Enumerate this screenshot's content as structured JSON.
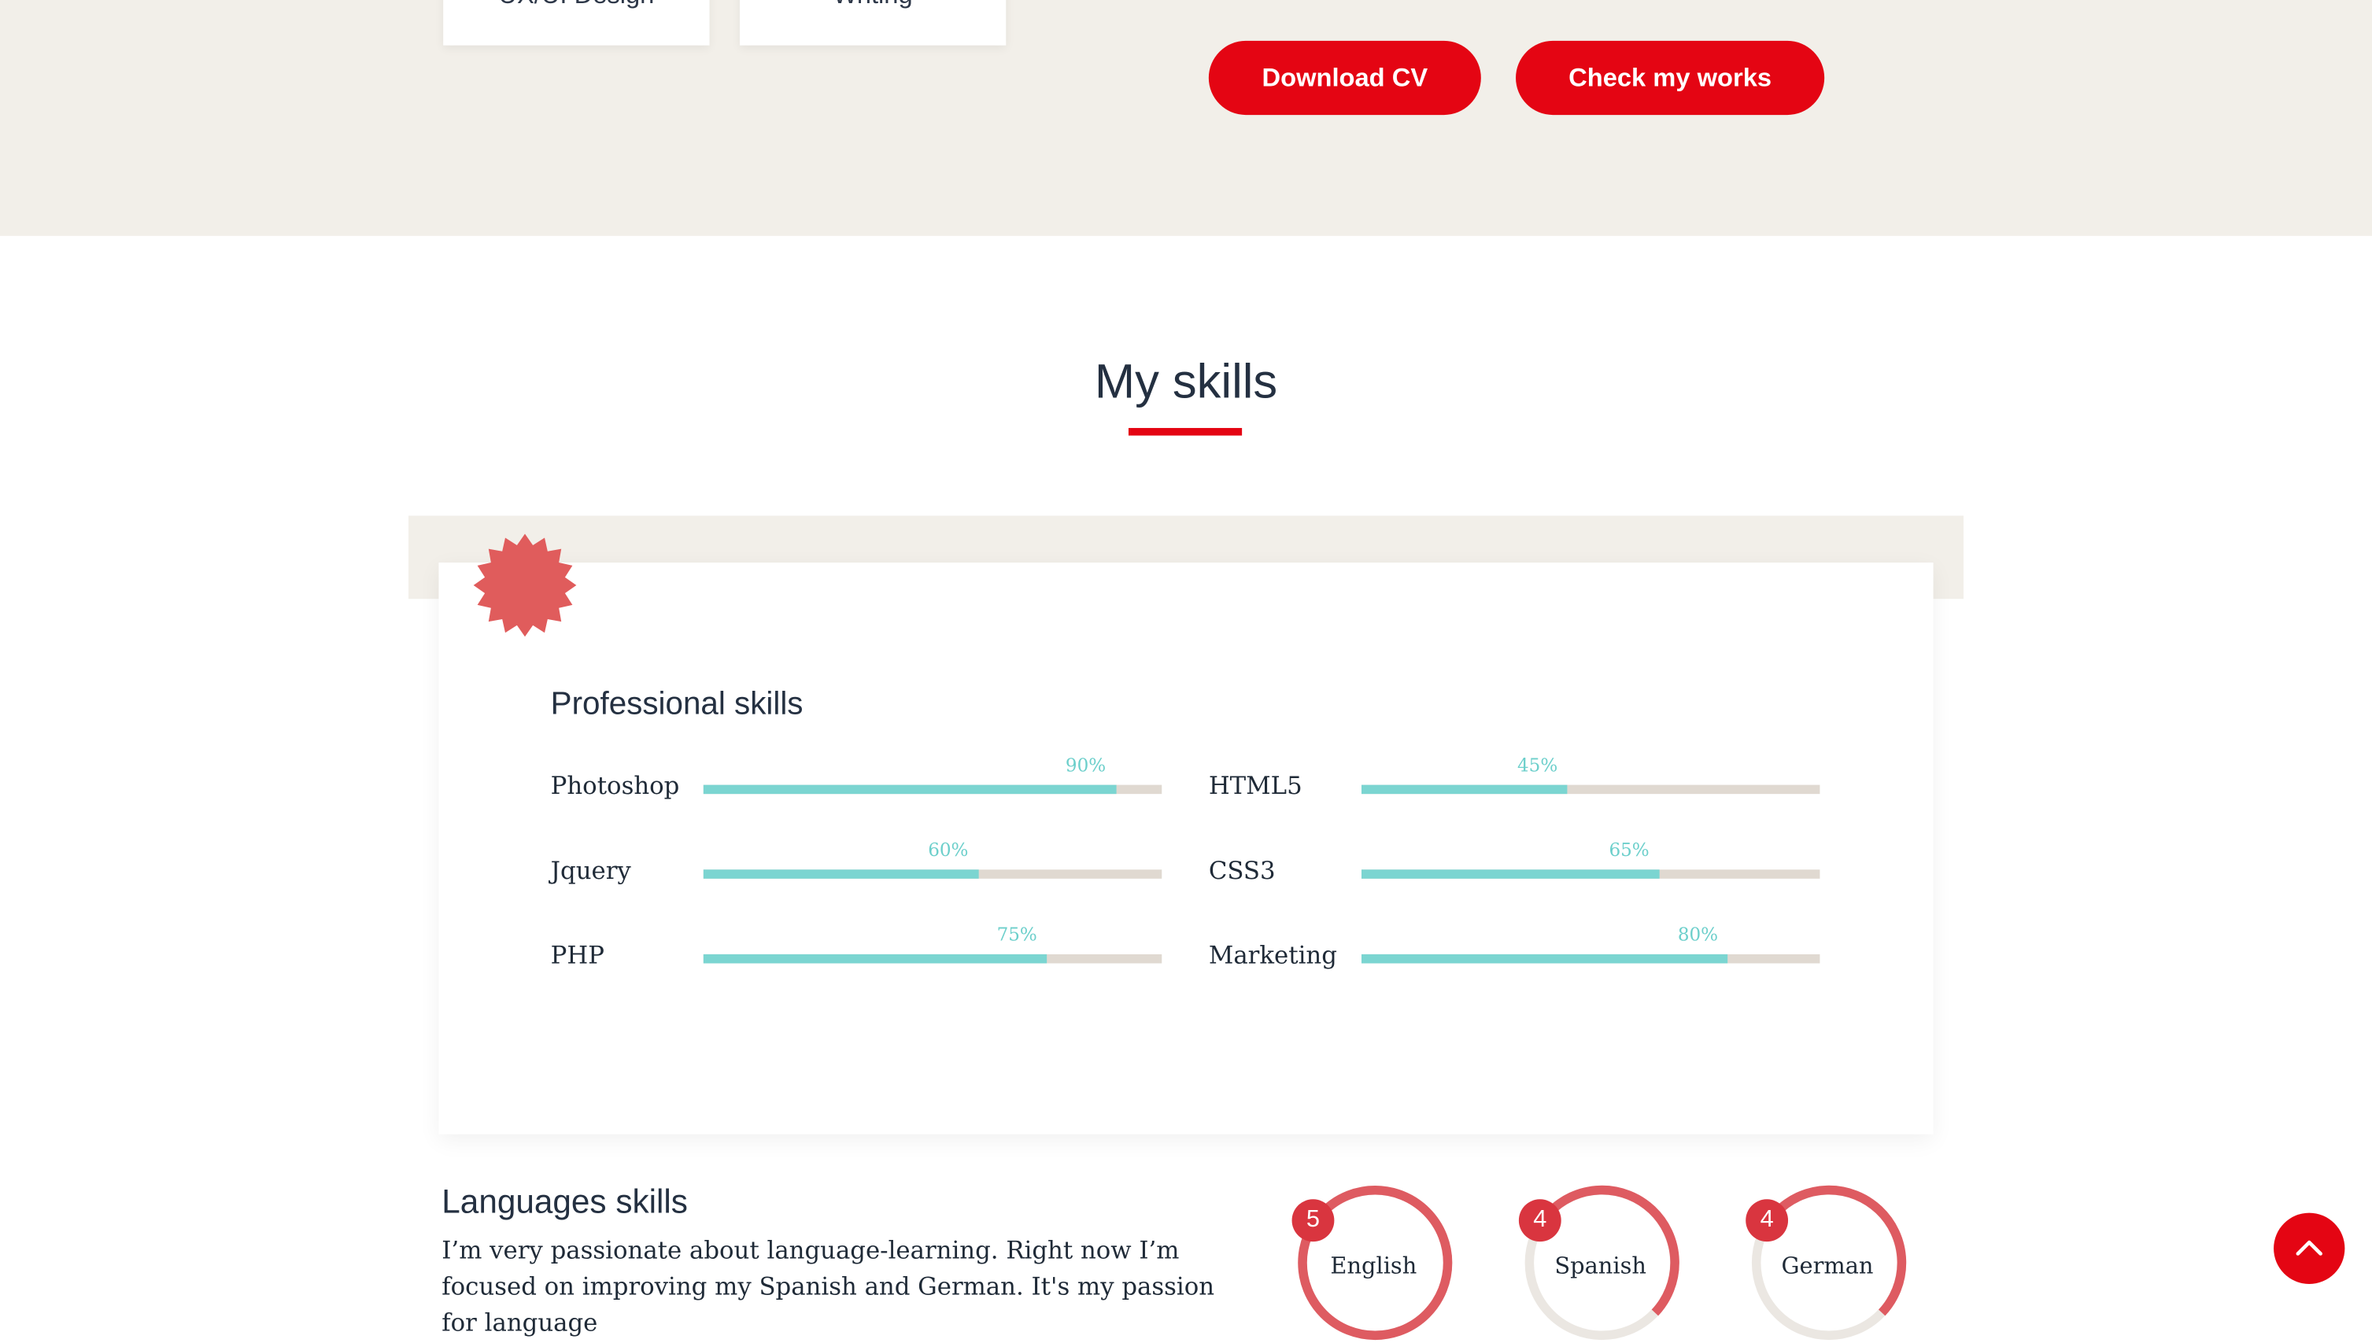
{
  "services": [
    {
      "label": "UX/UI Design"
    },
    {
      "label": "Writing"
    }
  ],
  "actions": {
    "download_cv": "Download CV",
    "check_works": "Check my works"
  },
  "skills_section": {
    "title": "My skills",
    "card_title": "Professional skills",
    "skills": [
      {
        "name": "Photoshop",
        "percent": 90,
        "label": "90%"
      },
      {
        "name": "HTML5",
        "percent": 45,
        "label": "45%"
      },
      {
        "name": "Jquery",
        "percent": 60,
        "label": "60%"
      },
      {
        "name": "CSS3",
        "percent": 65,
        "label": "65%"
      },
      {
        "name": "PHP",
        "percent": 75,
        "label": "75%"
      },
      {
        "name": "Marketing",
        "percent": 80,
        "label": "80%"
      }
    ]
  },
  "languages": {
    "title": "Languages skills",
    "description": "I’m very passionate about language-learning. Right now I’m focused on improving my Spanish and German. It's my passion for language",
    "items": [
      {
        "name": "English",
        "level": "5"
      },
      {
        "name": "Spanish",
        "level": "4"
      },
      {
        "name": "German",
        "level": "4"
      }
    ]
  },
  "colors": {
    "accent": "#e40513",
    "bar_fill": "#7bd5d1",
    "bar_track": "#e0d9d1",
    "ring": "#de5b61",
    "badge": "#e05c5c",
    "hero_bg": "#f2efe9"
  },
  "icons": {
    "badge": "starburst-badge-icon",
    "scroll_top": "chevron-up-icon"
  }
}
